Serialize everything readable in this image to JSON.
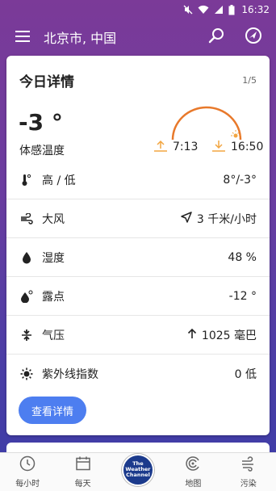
{
  "status_bar": {
    "time": "16:32"
  },
  "app_bar": {
    "location": "北京市, 中国"
  },
  "card": {
    "title": "今日详情",
    "page": "1/5",
    "temperature": "-3 °",
    "feels_like_label": "体感温度",
    "sunrise": "7:13",
    "sunset": "16:50",
    "rows": [
      {
        "icon": "thermometer-icon",
        "label": "高 / 低",
        "value": "8°/-3°"
      },
      {
        "icon": "wind-icon",
        "label": "大风",
        "value": "3 千米/小时",
        "value_icon": "wind-direction-icon"
      },
      {
        "icon": "humidity-icon",
        "label": "湿度",
        "value": "48 %"
      },
      {
        "icon": "dew-point-icon",
        "label": "露点",
        "value": "-12 °"
      },
      {
        "icon": "pressure-icon",
        "label": "气压",
        "value": "1025 毫巴",
        "value_icon": "arrow-up-icon"
      },
      {
        "icon": "uv-icon",
        "label": "紫外线指数",
        "value": "0 低"
      }
    ],
    "details_button": "查看详情"
  },
  "bottom_nav": {
    "hourly": "每小时",
    "daily": "每天",
    "logo_text": "The Weather Channel",
    "map": "地图",
    "pollution": "污染"
  },
  "colors": {
    "accent": "#4d7ef0",
    "sun_arc": "#e8792b",
    "sun_arrow": "#f2a541"
  }
}
